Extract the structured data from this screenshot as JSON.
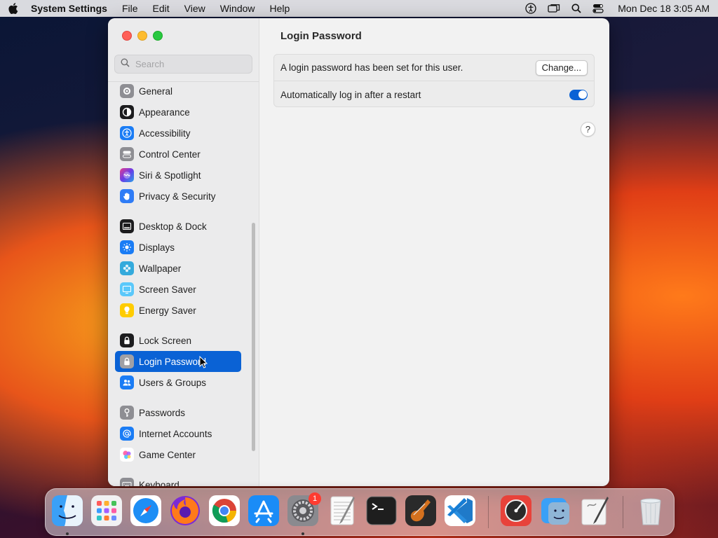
{
  "menubar": {
    "app_name": "System Settings",
    "menus": [
      "File",
      "Edit",
      "View",
      "Window",
      "Help"
    ],
    "clock": "Mon Dec 18  3:05 AM"
  },
  "sidebar": {
    "search_placeholder": "Search",
    "items": [
      {
        "label": "General",
        "icon": "gear-icon",
        "color": "#8e8e93"
      },
      {
        "label": "Appearance",
        "icon": "appearance-icon",
        "color": "#1c1c1e"
      },
      {
        "label": "Accessibility",
        "icon": "accessibility-icon",
        "color": "#1a7cf5"
      },
      {
        "label": "Control Center",
        "icon": "control-center-icon",
        "color": "#8e8e93"
      },
      {
        "label": "Siri & Spotlight",
        "icon": "siri-icon",
        "color": "#7b3fe4"
      },
      {
        "label": "Privacy & Security",
        "icon": "hand-icon",
        "color": "#2f7cf6"
      },
      {
        "label": "Desktop & Dock",
        "icon": "dock-icon",
        "color": "#1c1c1e"
      },
      {
        "label": "Displays",
        "icon": "sun-icon",
        "color": "#1a7cf5"
      },
      {
        "label": "Wallpaper",
        "icon": "wallpaper-icon",
        "color": "#34aadc"
      },
      {
        "label": "Screen Saver",
        "icon": "screen-saver-icon",
        "color": "#5ac8fa"
      },
      {
        "label": "Energy Saver",
        "icon": "battery-icon",
        "color": "#ffcc00"
      },
      {
        "label": "Lock Screen",
        "icon": "lock-icon",
        "color": "#1c1c1e"
      },
      {
        "label": "Login Password",
        "icon": "lock-icon",
        "color": "#8e8e93",
        "selected": true
      },
      {
        "label": "Users & Groups",
        "icon": "users-icon",
        "color": "#1a7cf5"
      },
      {
        "label": "Passwords",
        "icon": "key-icon",
        "color": "#8e8e93"
      },
      {
        "label": "Internet Accounts",
        "icon": "at-icon",
        "color": "#1a7cf5"
      },
      {
        "label": "Game Center",
        "icon": "game-center-icon",
        "color": "#ffffff"
      },
      {
        "label": "Keyboard",
        "icon": "keyboard-icon",
        "color": "#8e8e93"
      }
    ]
  },
  "content": {
    "title": "Login Password",
    "row1_text": "A login password has been set for this user.",
    "change_label": "Change...",
    "row2_text": "Automatically log in after a restart",
    "auto_login_enabled": true,
    "help_label": "?"
  },
  "dock": {
    "settings_badge": "1",
    "apps": [
      "Finder",
      "Launchpad",
      "Safari",
      "Firefox",
      "Chrome",
      "App Store",
      "System Settings",
      "TextEdit",
      "Terminal",
      "GarageBand",
      "Visual Studio Code",
      "Instruments",
      "Finder Alt",
      "Script Editor",
      "Trash"
    ]
  }
}
